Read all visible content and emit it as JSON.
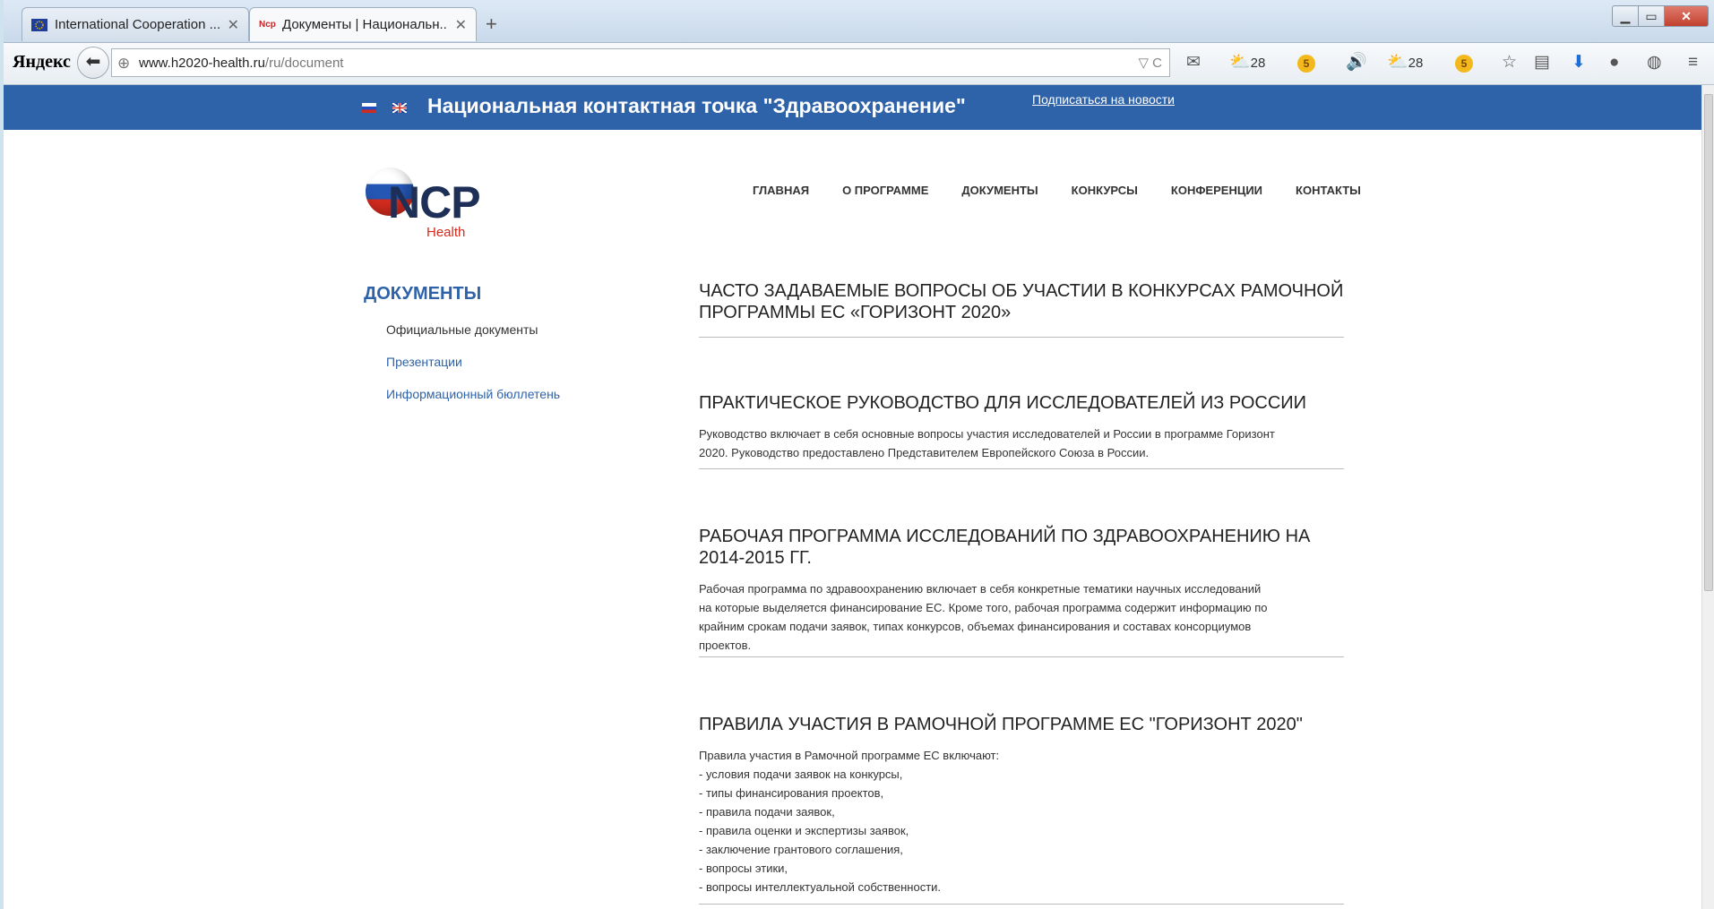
{
  "browser": {
    "tabs": [
      {
        "title": "International Cooperation ...",
        "active": false
      },
      {
        "title": "Документы | Национальн...",
        "active": true
      }
    ],
    "new_tab": "+",
    "brand": "Яндекс",
    "url_domain": "www.h2020-health.ru",
    "url_path": "/ru/document",
    "weather_1": "28",
    "weather_2": "28",
    "coin_label": "5"
  },
  "site": {
    "title": "Национальная контактная точка \"Здравоохранение\"",
    "subscribe_link": "Подписаться на новости",
    "logo_text": "NCP",
    "logo_sub": "Health",
    "nav": [
      "ГЛАВНАЯ",
      "О ПРОГРАММЕ",
      "ДОКУМЕНТЫ",
      "КОНКУРСЫ",
      "КОНФЕРЕНЦИИ",
      "КОНТАКТЫ"
    ]
  },
  "sidebar": {
    "title": "ДОКУМЕНТЫ",
    "items": [
      {
        "label": "Официальные документы",
        "active": true
      },
      {
        "label": "Презентации",
        "active": false
      },
      {
        "label": "Информационный бюллетень",
        "active": false
      }
    ]
  },
  "documents": [
    {
      "title_lines": [
        "ЧАСТО ЗАДАВАЕМЫЕ ВОПРОСЫ ОБ УЧАСТИИ В КОНКУРСАХ РАМОЧНОЙ",
        "ПРОГРАММЫ ЕС «ГОРИЗОНТ 2020»"
      ],
      "desc_lines": []
    },
    {
      "title_lines": [
        "ПРАКТИЧЕСКОЕ РУКОВОДСТВО ДЛЯ ИССЛЕДОВАТЕЛЕЙ ИЗ РОССИИ"
      ],
      "desc_lines": [
        "Руководство включает в себя основные вопросы участия исследователей и России в программе Горизонт",
        "2020. Руководство предоставлено Представителем Европейского Союза в России."
      ]
    },
    {
      "title_lines": [
        "РАБОЧАЯ ПРОГРАММА ИССЛЕДОВАНИЙ ПО ЗДРАВООХРАНЕНИЮ НА",
        "2014-2015 ГГ."
      ],
      "desc_lines": [
        "Рабочая программа по здравоохранению включает в себя конкретные тематики научных исследований",
        "на которые выделяется финансирование ЕС. Кроме того, рабочая программа содержит информацию по",
        "крайним срокам подачи заявок, типах конкурсов, объемах финансирования и составах консорциумов",
        "проектов."
      ]
    },
    {
      "title_lines": [
        "ПРАВИЛА УЧАСТИЯ В РАМОЧНОЙ ПРОГРАММЕ ЕС \"ГОРИЗОНТ 2020\""
      ],
      "desc_lines": [
        "Правила участия в Рамочной программе ЕС включают:",
        "- условия подачи заявок на конкурсы,",
        "- типы финансирования проектов,",
        "- правила подачи заявок,",
        "- правила оценки и экспертизы заявок,",
        "- заключение грантового соглашения,",
        "- вопросы этики,",
        "- вопросы интеллектуальной собственности."
      ]
    }
  ]
}
